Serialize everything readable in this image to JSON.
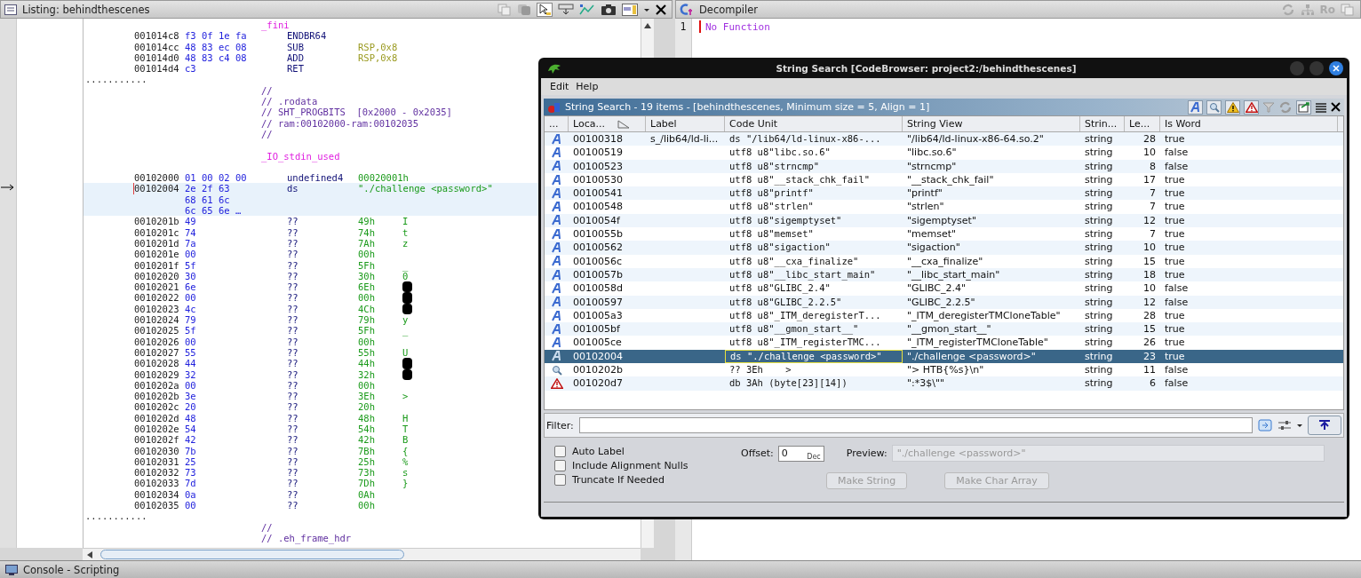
{
  "listing": {
    "title": "Listing:  behindthescenes",
    "lines": [
      {
        "kind": "label",
        "text": "_fini"
      },
      {
        "kind": "instruction",
        "address": "001014c8",
        "bytes": "f3 0f 1e fa",
        "mnemonic": "ENDBR64",
        "selected": false
      },
      {
        "kind": "instruction",
        "address": "001014cc",
        "bytes": "48 83 ec 08",
        "mnemonic": "SUB",
        "operand": "RSP,0x8",
        "selected": false
      },
      {
        "kind": "instruction",
        "address": "001014d0",
        "bytes": "48 83 c4 08",
        "mnemonic": "ADD",
        "operand": "RSP,0x8",
        "selected": false
      },
      {
        "kind": "instruction",
        "address": "001014d4",
        "bytes": "c3",
        "mnemonic": "RET",
        "selected": false
      },
      {
        "kind": "separator",
        "text": "..........."
      },
      {
        "kind": "comment",
        "text": "//"
      },
      {
        "kind": "comment",
        "text": "// .rodata"
      },
      {
        "kind": "comment",
        "text": "// SHT_PROGBITS  [0x2000 - 0x2035]"
      },
      {
        "kind": "comment",
        "text": "// ram:00102000-ram:00102035"
      },
      {
        "kind": "comment",
        "text": "//"
      },
      {
        "kind": "blank"
      },
      {
        "kind": "label",
        "text": "_IO_stdin_used"
      },
      {
        "kind": "blank"
      },
      {
        "kind": "data",
        "address": "00102000",
        "bytes": "01 00 02 00",
        "mnemonic": "undefined4",
        "operand": "00020001h",
        "selected": false
      },
      {
        "kind": "data",
        "address": "00102004",
        "bytes": "2e 2f 63",
        "mnemonic": "ds",
        "operand": "\"./challenge <password>\"",
        "more_bytes": [
          "68 61 6c",
          "6c 65 6e …"
        ],
        "selected": true
      },
      {
        "kind": "data",
        "address": "0010201b",
        "bytes": "49",
        "mnemonic": "??",
        "operand": "49h",
        "char": "I",
        "selected": false
      },
      {
        "kind": "data",
        "address": "0010201c",
        "bytes": "74",
        "mnemonic": "??",
        "operand": "74h",
        "char": "t",
        "selected": false
      },
      {
        "kind": "data",
        "address": "0010201d",
        "bytes": "7a",
        "mnemonic": "??",
        "operand": "7Ah",
        "char": "z",
        "selected": false
      },
      {
        "kind": "data",
        "address": "0010201e",
        "bytes": "00",
        "mnemonic": "??",
        "operand": "00h",
        "selected": false
      },
      {
        "kind": "data",
        "address": "0010201f",
        "bytes": "5f",
        "mnemonic": "??",
        "operand": "5Fh",
        "char": "_",
        "selected": false
      },
      {
        "kind": "data",
        "address": "00102020",
        "bytes": "30",
        "mnemonic": "??",
        "operand": "30h",
        "char": "0",
        "selected": false
      },
      {
        "kind": "data",
        "address": "00102021",
        "bytes": "6e",
        "mnemonic": "??",
        "operand": "6Eh",
        "redacted": true,
        "selected": false
      },
      {
        "kind": "data",
        "address": "00102022",
        "bytes": "00",
        "mnemonic": "??",
        "operand": "00h",
        "redacted": true,
        "selected": false
      },
      {
        "kind": "data",
        "address": "00102023",
        "bytes": "4c",
        "mnemonic": "??",
        "operand": "4Ch",
        "redacted": true,
        "selected": false
      },
      {
        "kind": "data",
        "address": "00102024",
        "bytes": "79",
        "mnemonic": "??",
        "operand": "79h",
        "char": "y",
        "selected": false
      },
      {
        "kind": "data",
        "address": "00102025",
        "bytes": "5f",
        "mnemonic": "??",
        "operand": "5Fh",
        "char": "_",
        "selected": false
      },
      {
        "kind": "data",
        "address": "00102026",
        "bytes": "00",
        "mnemonic": "??",
        "operand": "00h",
        "selected": false
      },
      {
        "kind": "data",
        "address": "00102027",
        "bytes": "55",
        "mnemonic": "??",
        "operand": "55h",
        "char": "U",
        "selected": false
      },
      {
        "kind": "data",
        "address": "00102028",
        "bytes": "44",
        "mnemonic": "??",
        "operand": "44h",
        "redacted": true,
        "selected": false
      },
      {
        "kind": "data",
        "address": "00102029",
        "bytes": "32",
        "mnemonic": "??",
        "operand": "32h",
        "redacted": true,
        "selected": false
      },
      {
        "kind": "data",
        "address": "0010202a",
        "bytes": "00",
        "mnemonic": "??",
        "operand": "00h",
        "selected": false
      },
      {
        "kind": "data",
        "address": "0010202b",
        "bytes": "3e",
        "mnemonic": "??",
        "operand": "3Eh",
        "char": ">",
        "selected": false
      },
      {
        "kind": "data",
        "address": "0010202c",
        "bytes": "20",
        "mnemonic": "??",
        "operand": "20h",
        "selected": false
      },
      {
        "kind": "data",
        "address": "0010202d",
        "bytes": "48",
        "mnemonic": "??",
        "operand": "48h",
        "char": "H",
        "selected": false
      },
      {
        "kind": "data",
        "address": "0010202e",
        "bytes": "54",
        "mnemonic": "??",
        "operand": "54h",
        "char": "T",
        "selected": false
      },
      {
        "kind": "data",
        "address": "0010202f",
        "bytes": "42",
        "mnemonic": "??",
        "operand": "42h",
        "char": "B",
        "selected": false
      },
      {
        "kind": "data",
        "address": "00102030",
        "bytes": "7b",
        "mnemonic": "??",
        "operand": "7Bh",
        "char": "{",
        "selected": false
      },
      {
        "kind": "data",
        "address": "00102031",
        "bytes": "25",
        "mnemonic": "??",
        "operand": "25h",
        "char": "%",
        "selected": false
      },
      {
        "kind": "data",
        "address": "00102032",
        "bytes": "73",
        "mnemonic": "??",
        "operand": "73h",
        "char": "s",
        "selected": false
      },
      {
        "kind": "data",
        "address": "00102033",
        "bytes": "7d",
        "mnemonic": "??",
        "operand": "7Dh",
        "char": "}",
        "selected": false
      },
      {
        "kind": "data",
        "address": "00102034",
        "bytes": "0a",
        "mnemonic": "??",
        "operand": "0Ah",
        "selected": false
      },
      {
        "kind": "data",
        "address": "00102035",
        "bytes": "00",
        "mnemonic": "??",
        "operand": "00h",
        "selected": false
      },
      {
        "kind": "separator",
        "text": "..........."
      },
      {
        "kind": "comment",
        "text": "//"
      },
      {
        "kind": "comment",
        "text": "// .eh_frame_hdr"
      }
    ]
  },
  "decompiler": {
    "title": "Decompiler",
    "toolbar_text": "Ro",
    "lines": [
      {
        "number": "1",
        "text": "No Function"
      }
    ]
  },
  "dialog": {
    "title": "String Search [CodeBrowser: project2:/behindthescenes]",
    "menu": [
      "Edit",
      "Help"
    ],
    "panel_title": "String Search - 19 items - [behindthescenes, Minimum size = 5, Align = 1]",
    "columns": [
      "...",
      "Loca...",
      "Label",
      "Code Unit",
      "String View",
      "Strin...",
      "Le...",
      "Is Word"
    ],
    "rows": [
      {
        "kind": "string",
        "location": "00100318",
        "label": "s_/lib64/ld-li...",
        "code_unit": "ds \"/lib64/ld-linux-x86-...",
        "string_view": "\"/lib64/ld-linux-x86-64.so.2\"",
        "type": "string",
        "length": "28",
        "is_word": "true",
        "selected": false
      },
      {
        "kind": "string",
        "location": "00100519",
        "code_unit": "utf8 u8\"libc.so.6\"",
        "string_view": "\"libc.so.6\"",
        "type": "string",
        "length": "10",
        "is_word": "false",
        "selected": false
      },
      {
        "kind": "string",
        "location": "00100523",
        "code_unit": "utf8 u8\"strncmp\"",
        "string_view": "\"strncmp\"",
        "type": "string",
        "length": "8",
        "is_word": "false",
        "selected": false
      },
      {
        "kind": "string",
        "location": "00100530",
        "code_unit": "utf8 u8\"__stack_chk_fail\"",
        "string_view": "\"__stack_chk_fail\"",
        "type": "string",
        "length": "17",
        "is_word": "true",
        "selected": false
      },
      {
        "kind": "string",
        "location": "00100541",
        "code_unit": "utf8 u8\"printf\"",
        "string_view": "\"printf\"",
        "type": "string",
        "length": "7",
        "is_word": "true",
        "selected": false
      },
      {
        "kind": "string",
        "location": "00100548",
        "code_unit": "utf8 u8\"strlen\"",
        "string_view": "\"strlen\"",
        "type": "string",
        "length": "7",
        "is_word": "true",
        "selected": false
      },
      {
        "kind": "string",
        "location": "0010054f",
        "code_unit": "utf8 u8\"sigemptyset\"",
        "string_view": "\"sigemptyset\"",
        "type": "string",
        "length": "12",
        "is_word": "true",
        "selected": false
      },
      {
        "kind": "string",
        "location": "0010055b",
        "code_unit": "utf8 u8\"memset\"",
        "string_view": "\"memset\"",
        "type": "string",
        "length": "7",
        "is_word": "true",
        "selected": false
      },
      {
        "kind": "string",
        "location": "00100562",
        "code_unit": "utf8 u8\"sigaction\"",
        "string_view": "\"sigaction\"",
        "type": "string",
        "length": "10",
        "is_word": "true",
        "selected": false
      },
      {
        "kind": "string",
        "location": "0010056c",
        "code_unit": "utf8 u8\"__cxa_finalize\"",
        "string_view": "\"__cxa_finalize\"",
        "type": "string",
        "length": "15",
        "is_word": "true",
        "selected": false
      },
      {
        "kind": "string",
        "location": "0010057b",
        "code_unit": "utf8 u8\"__libc_start_main\"",
        "string_view": "\"__libc_start_main\"",
        "type": "string",
        "length": "18",
        "is_word": "true",
        "selected": false
      },
      {
        "kind": "string",
        "location": "0010058d",
        "code_unit": "utf8 u8\"GLIBC_2.4\"",
        "string_view": "\"GLIBC_2.4\"",
        "type": "string",
        "length": "10",
        "is_word": "false",
        "selected": false
      },
      {
        "kind": "string",
        "location": "00100597",
        "code_unit": "utf8 u8\"GLIBC_2.2.5\"",
        "string_view": "\"GLIBC_2.2.5\"",
        "type": "string",
        "length": "12",
        "is_word": "false",
        "selected": false
      },
      {
        "kind": "string",
        "location": "001005a3",
        "code_unit": "utf8 u8\"_ITM_deregisterT...",
        "string_view": "\"_ITM_deregisterTMCloneTable\"",
        "type": "string",
        "length": "28",
        "is_word": "true",
        "selected": false
      },
      {
        "kind": "string",
        "location": "001005bf",
        "code_unit": "utf8 u8\"__gmon_start__\"",
        "string_view": "\"__gmon_start__\"",
        "type": "string",
        "length": "15",
        "is_word": "true",
        "selected": false
      },
      {
        "kind": "string",
        "location": "001005ce",
        "code_unit": "utf8 u8\"_ITM_registerTMC...",
        "string_view": "\"_ITM_registerTMCloneTable\"",
        "type": "string",
        "length": "26",
        "is_word": "true",
        "selected": false
      },
      {
        "kind": "string",
        "location": "00102004",
        "code_unit": "ds \"./challenge <password>\"",
        "string_view": "\"./challenge <password>\"",
        "type": "string",
        "length": "23",
        "is_word": "true",
        "selected": true
      },
      {
        "kind": "search",
        "location": "0010202b",
        "code_unit": "?? 3Eh    >",
        "string_view": "\"> HTB{%s}\\n\"",
        "type": "string",
        "length": "11",
        "is_word": "false",
        "selected": false
      },
      {
        "kind": "warning",
        "location": "001020d7",
        "code_unit": "db 3Ah (byte[23][14])",
        "string_view": "\":*3$\\\"\"",
        "type": "string",
        "length": "6",
        "is_word": "false",
        "selected": false
      }
    ],
    "filter": {
      "label": "Filter:"
    },
    "options": [
      {
        "label": "Auto Label",
        "checked": false
      },
      {
        "label": "Include Alignment Nulls",
        "checked": false
      },
      {
        "label": "Truncate If Needed",
        "checked": false
      }
    ],
    "offset": {
      "label": "Offset:",
      "value": "0",
      "unit": "Dec"
    },
    "preview": {
      "label": "Preview:",
      "value": "\"./challenge <password>\""
    },
    "buttons": [
      {
        "label": "Make String",
        "disabled": true
      },
      {
        "label": "Make Char Array",
        "disabled": true
      }
    ]
  },
  "console": {
    "title": "Console - Scripting"
  }
}
